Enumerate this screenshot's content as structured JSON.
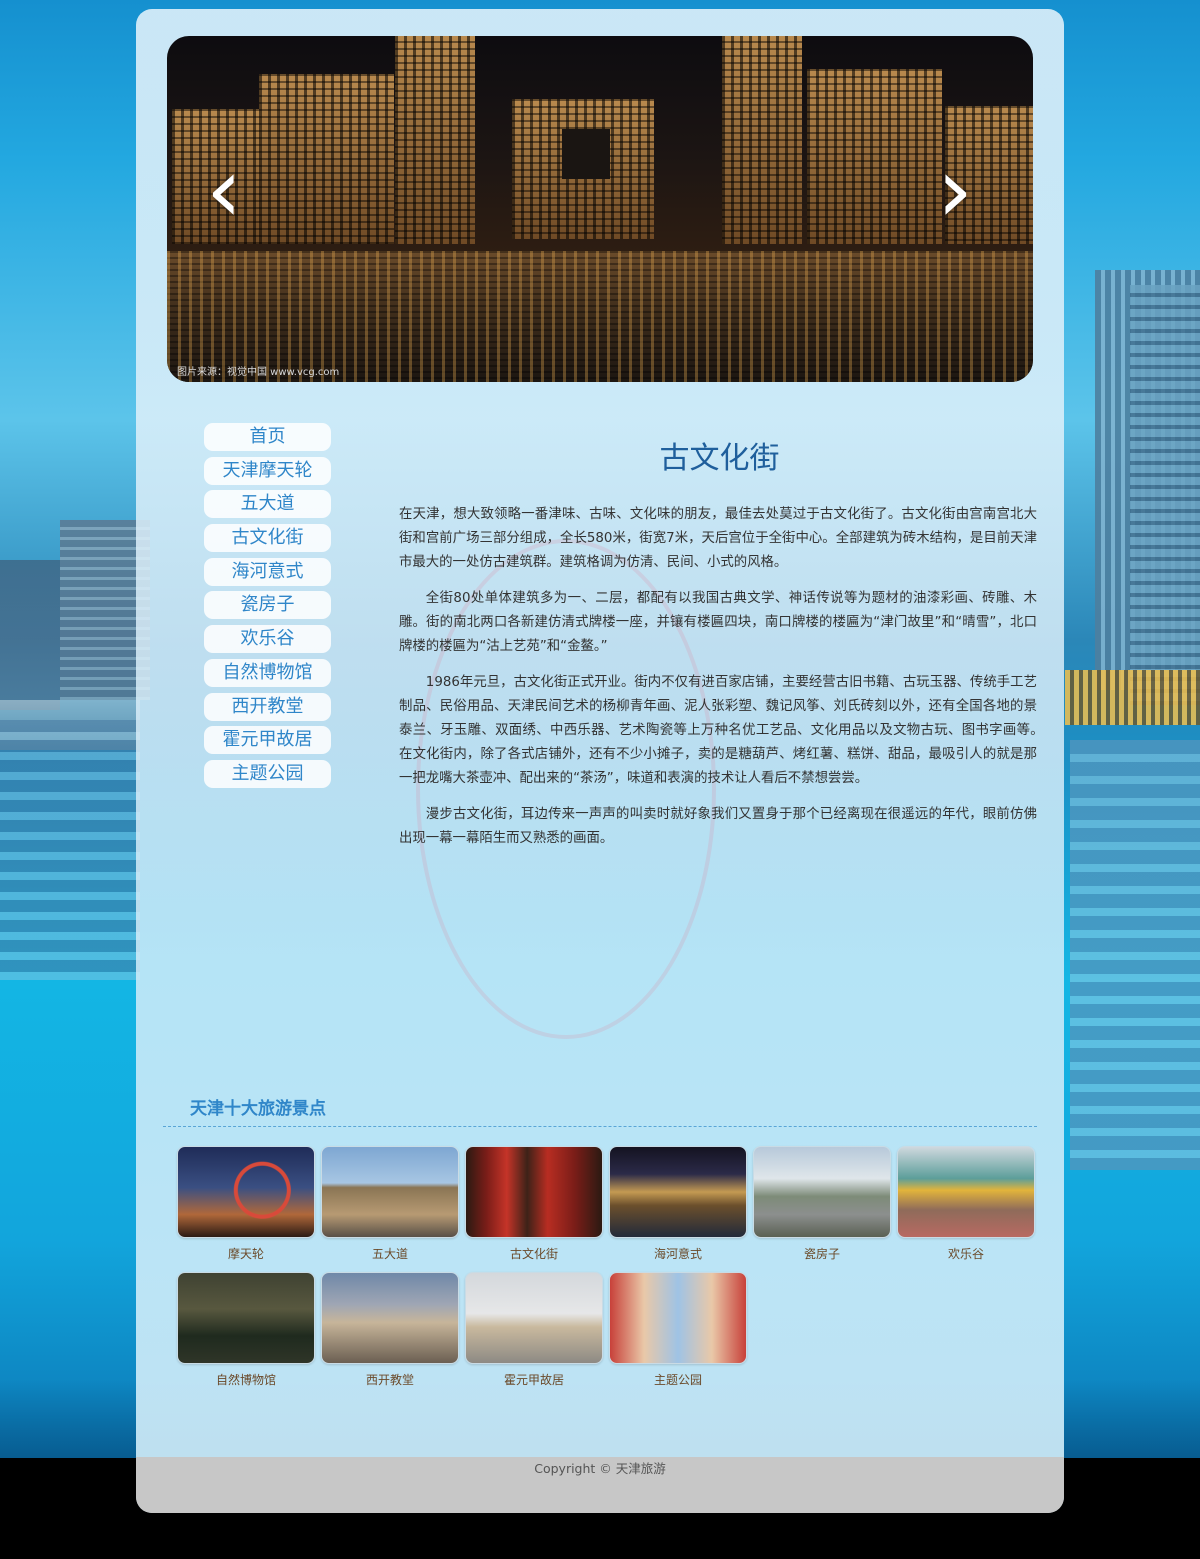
{
  "banner": {
    "prev_label": "‹",
    "next_label": "›",
    "credit": "图片来源：视觉中国 www.vcg.com"
  },
  "nav": {
    "items": [
      {
        "label": "首页"
      },
      {
        "label": "天津摩天轮"
      },
      {
        "label": "五大道"
      },
      {
        "label": "古文化街"
      },
      {
        "label": "海河意式"
      },
      {
        "label": "瓷房子"
      },
      {
        "label": "欢乐谷"
      },
      {
        "label": "自然博物馆"
      },
      {
        "label": "西开教堂"
      },
      {
        "label": "霍元甲故居"
      },
      {
        "label": "主题公园"
      }
    ]
  },
  "article": {
    "title": "古文化街",
    "paragraphs": [
      "在天津，想大致领略一番津味、古味、文化味的朋友，最佳去处莫过于古文化街了。古文化街由宫南宫北大街和宫前广场三部分组成，全长580米，街宽7米，天后宫位于全街中心。全部建筑为砖木结构，是目前天津市最大的一处仿古建筑群。建筑格调为仿清、民间、小式的风格。",
      "全街80处单体建筑多为一、二层，都配有以我国古典文学、神话传说等为题材的油漆彩画、砖雕、木雕。街的南北两口各新建仿清式牌楼一座，并镶有楼匾四块，南口牌楼的楼匾为“津门故里”和“晴雪”，北口牌楼的楼匾为“沽上艺苑”和“金鳌。”",
      "1986年元旦，古文化街正式开业。街内不仅有进百家店铺，主要经营古旧书籍、古玩玉器、传统手工艺制品、民俗用品、天津民间艺术的杨柳青年画、泥人张彩塑、魏记风筝、刘氏砖刻以外，还有全国各地的景泰兰、牙玉雕、双面绣、中西乐器、艺术陶瓷等上万种名优工艺品、文化用品以及文物古玩、图书字画等。　　在文化街内，除了各式店铺外，还有不少小摊子，卖的是糖葫芦、烤红薯、糕饼、甜品，最吸引人的就是那一把龙嘴大茶壶冲、配出来的“茶汤”，味道和表演的技术让人看后不禁想尝尝。",
      "漫步古文化街，耳边传来一声声的叫卖时就好象我们又置身于那个已经离现在很遥远的年代，眼前仿佛出现一幕一幕陌生而又熟悉的画面。"
    ]
  },
  "gallery": {
    "title": "天津十大旅游景点",
    "items": [
      {
        "label": "摩天轮"
      },
      {
        "label": "五大道"
      },
      {
        "label": "古文化街"
      },
      {
        "label": "海河意式"
      },
      {
        "label": "瓷房子"
      },
      {
        "label": "欢乐谷"
      },
      {
        "label": "自然博物馆"
      },
      {
        "label": "西开教堂"
      },
      {
        "label": "霍元甲故居"
      },
      {
        "label": "主题公园"
      }
    ]
  },
  "footer": {
    "text": "Copyright © 天津旅游"
  },
  "colors": {
    "accent": "#2f86c9",
    "title": "#1f5f9c",
    "footer_bg": "#c7c7c7"
  }
}
